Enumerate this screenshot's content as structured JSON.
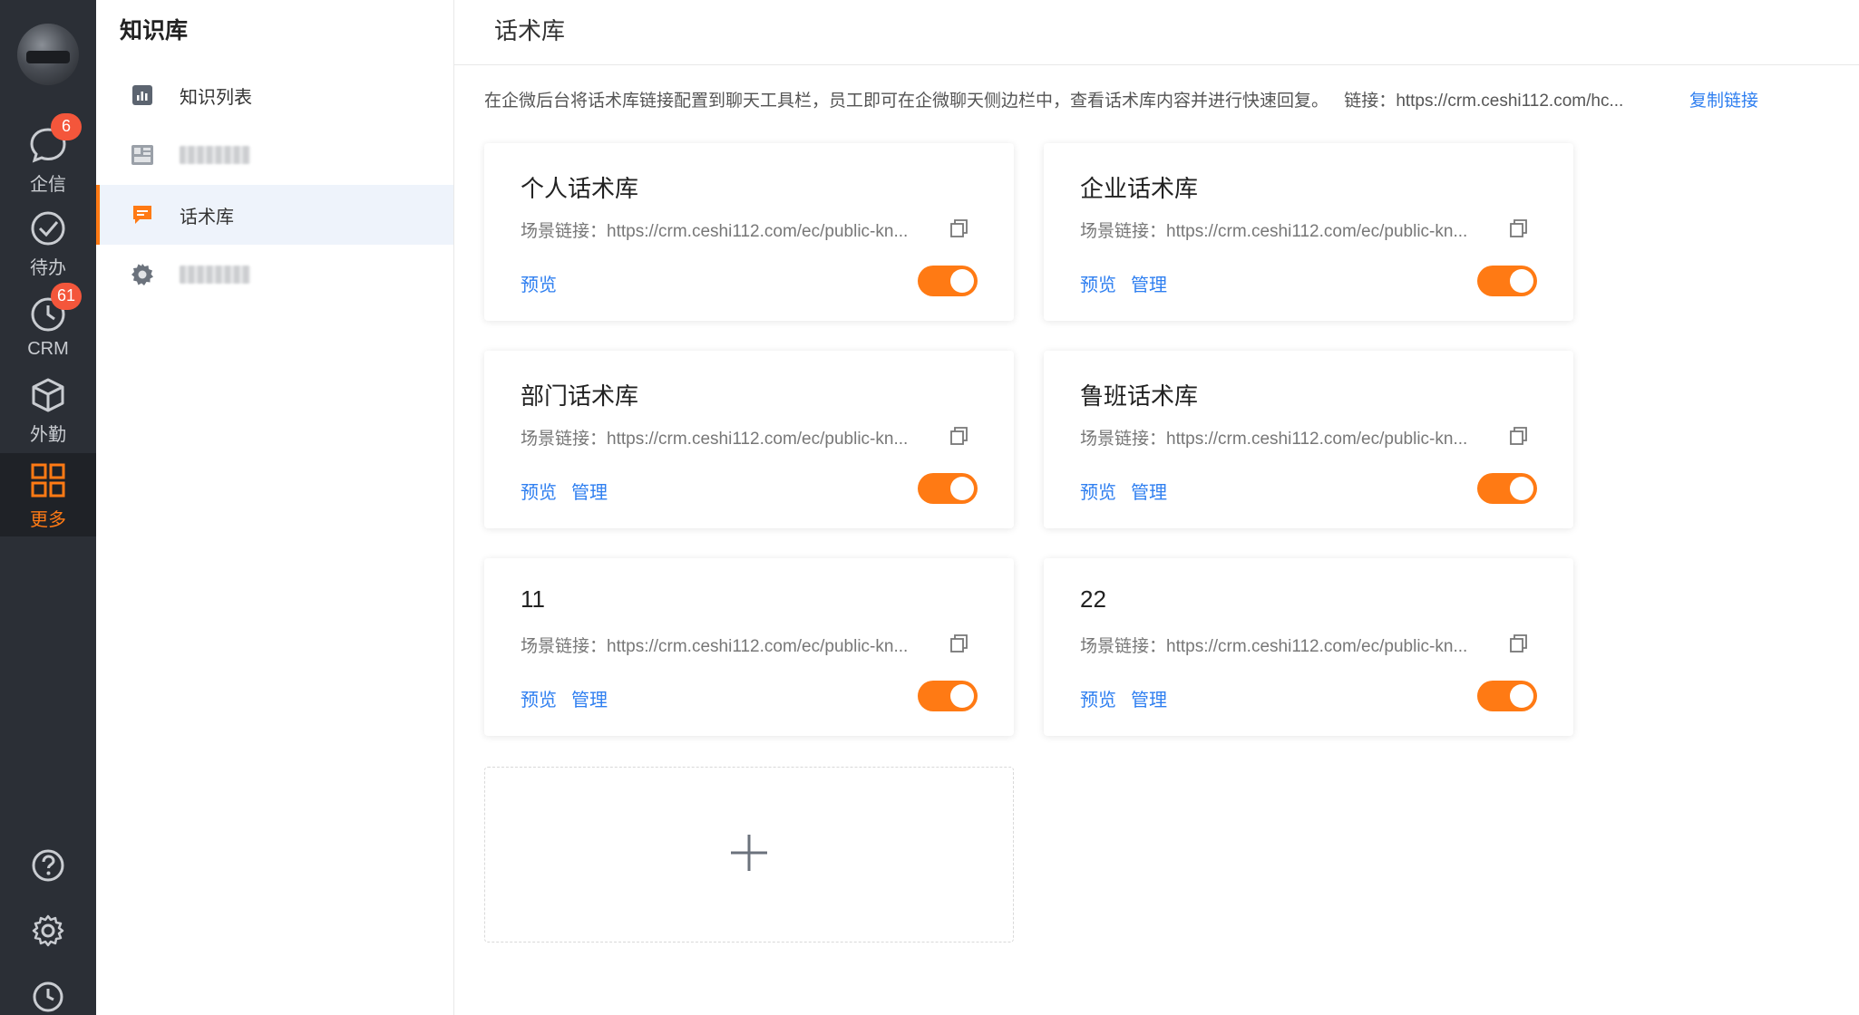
{
  "rail": {
    "items": [
      {
        "label": "企信",
        "badge": "6"
      },
      {
        "label": "待办",
        "badge": ""
      },
      {
        "label": "CRM",
        "badge": "61"
      },
      {
        "label": "外勤",
        "badge": ""
      },
      {
        "label": "更多",
        "badge": ""
      }
    ],
    "colors": {
      "bg": "#2b2f36",
      "active": "#ff7a14",
      "badge": "#f4563b"
    }
  },
  "sidebar": {
    "title": "知识库",
    "items": [
      {
        "label": "知识列表",
        "icon": "bar-chart-icon"
      },
      {
        "label": "",
        "icon": "scene-grid-icon"
      },
      {
        "label": "话术库",
        "icon": "chat-icon"
      },
      {
        "label": "",
        "icon": "cog-icon"
      }
    ]
  },
  "header": {
    "title": "话术库"
  },
  "info": {
    "text": "在企微后台将话术库链接配置到聊天工具栏，员工即可在企微聊天侧边栏中，查看话术库内容并进行快速回复。",
    "link_label": "链接：",
    "link_url": "https://crm.ceshi112.com/hc...",
    "copy_label": "复制链接"
  },
  "cards": [
    {
      "title": "个人话术库",
      "link": "场景链接：https://crm.ceshi112.com/ec/public-kn...",
      "actions": [
        "预览"
      ],
      "enabled": true
    },
    {
      "title": "企业话术库",
      "link": "场景链接：https://crm.ceshi112.com/ec/public-kn...",
      "actions": [
        "预览",
        "管理"
      ],
      "enabled": true
    },
    {
      "title": "部门话术库",
      "link": "场景链接：https://crm.ceshi112.com/ec/public-kn...",
      "actions": [
        "预览",
        "管理"
      ],
      "enabled": true
    },
    {
      "title": "鲁班话术库",
      "link": "场景链接：https://crm.ceshi112.com/ec/public-kn...",
      "actions": [
        "预览",
        "管理"
      ],
      "enabled": true
    },
    {
      "title": "11",
      "link": "场景链接：https://crm.ceshi112.com/ec/public-kn...",
      "actions": [
        "预览",
        "管理"
      ],
      "enabled": true
    },
    {
      "title": "22",
      "link": "场景链接：https://crm.ceshi112.com/ec/public-kn...",
      "actions": [
        "预览",
        "管理"
      ],
      "enabled": true
    }
  ],
  "colors": {
    "accent": "#ff7a14",
    "link": "#2f7ff0"
  }
}
